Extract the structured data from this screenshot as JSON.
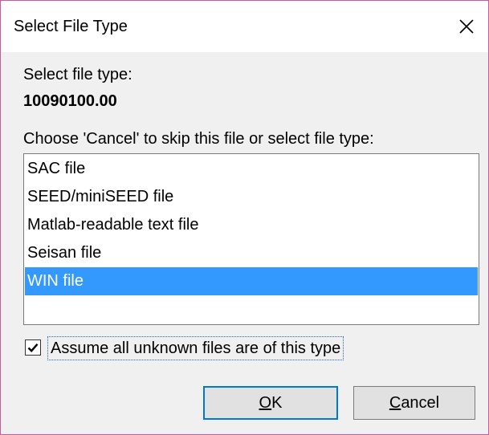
{
  "window": {
    "title": "Select File Type"
  },
  "prompt": "Select file type:",
  "filename": "10090100.00",
  "instruction": "Choose 'Cancel' to skip this file or select file type:",
  "file_types": {
    "items": [
      {
        "label": "SAC file",
        "selected": false
      },
      {
        "label": "SEED/miniSEED file",
        "selected": false
      },
      {
        "label": "Matlab-readable text file",
        "selected": false
      },
      {
        "label": "Seisan file",
        "selected": false
      },
      {
        "label": "WIN file",
        "selected": true
      }
    ]
  },
  "assume_checkbox": {
    "label": "Assume all unknown files are of this type",
    "checked": true
  },
  "buttons": {
    "ok": {
      "accel": "O",
      "rest": "K"
    },
    "cancel": {
      "accel": "C",
      "rest": "ancel"
    }
  },
  "colors": {
    "selection": "#3399ff",
    "frame": "#c85aa3",
    "focus": "#0078d7"
  },
  "icons": {
    "close": "close-icon",
    "check": "checkmark-icon"
  }
}
